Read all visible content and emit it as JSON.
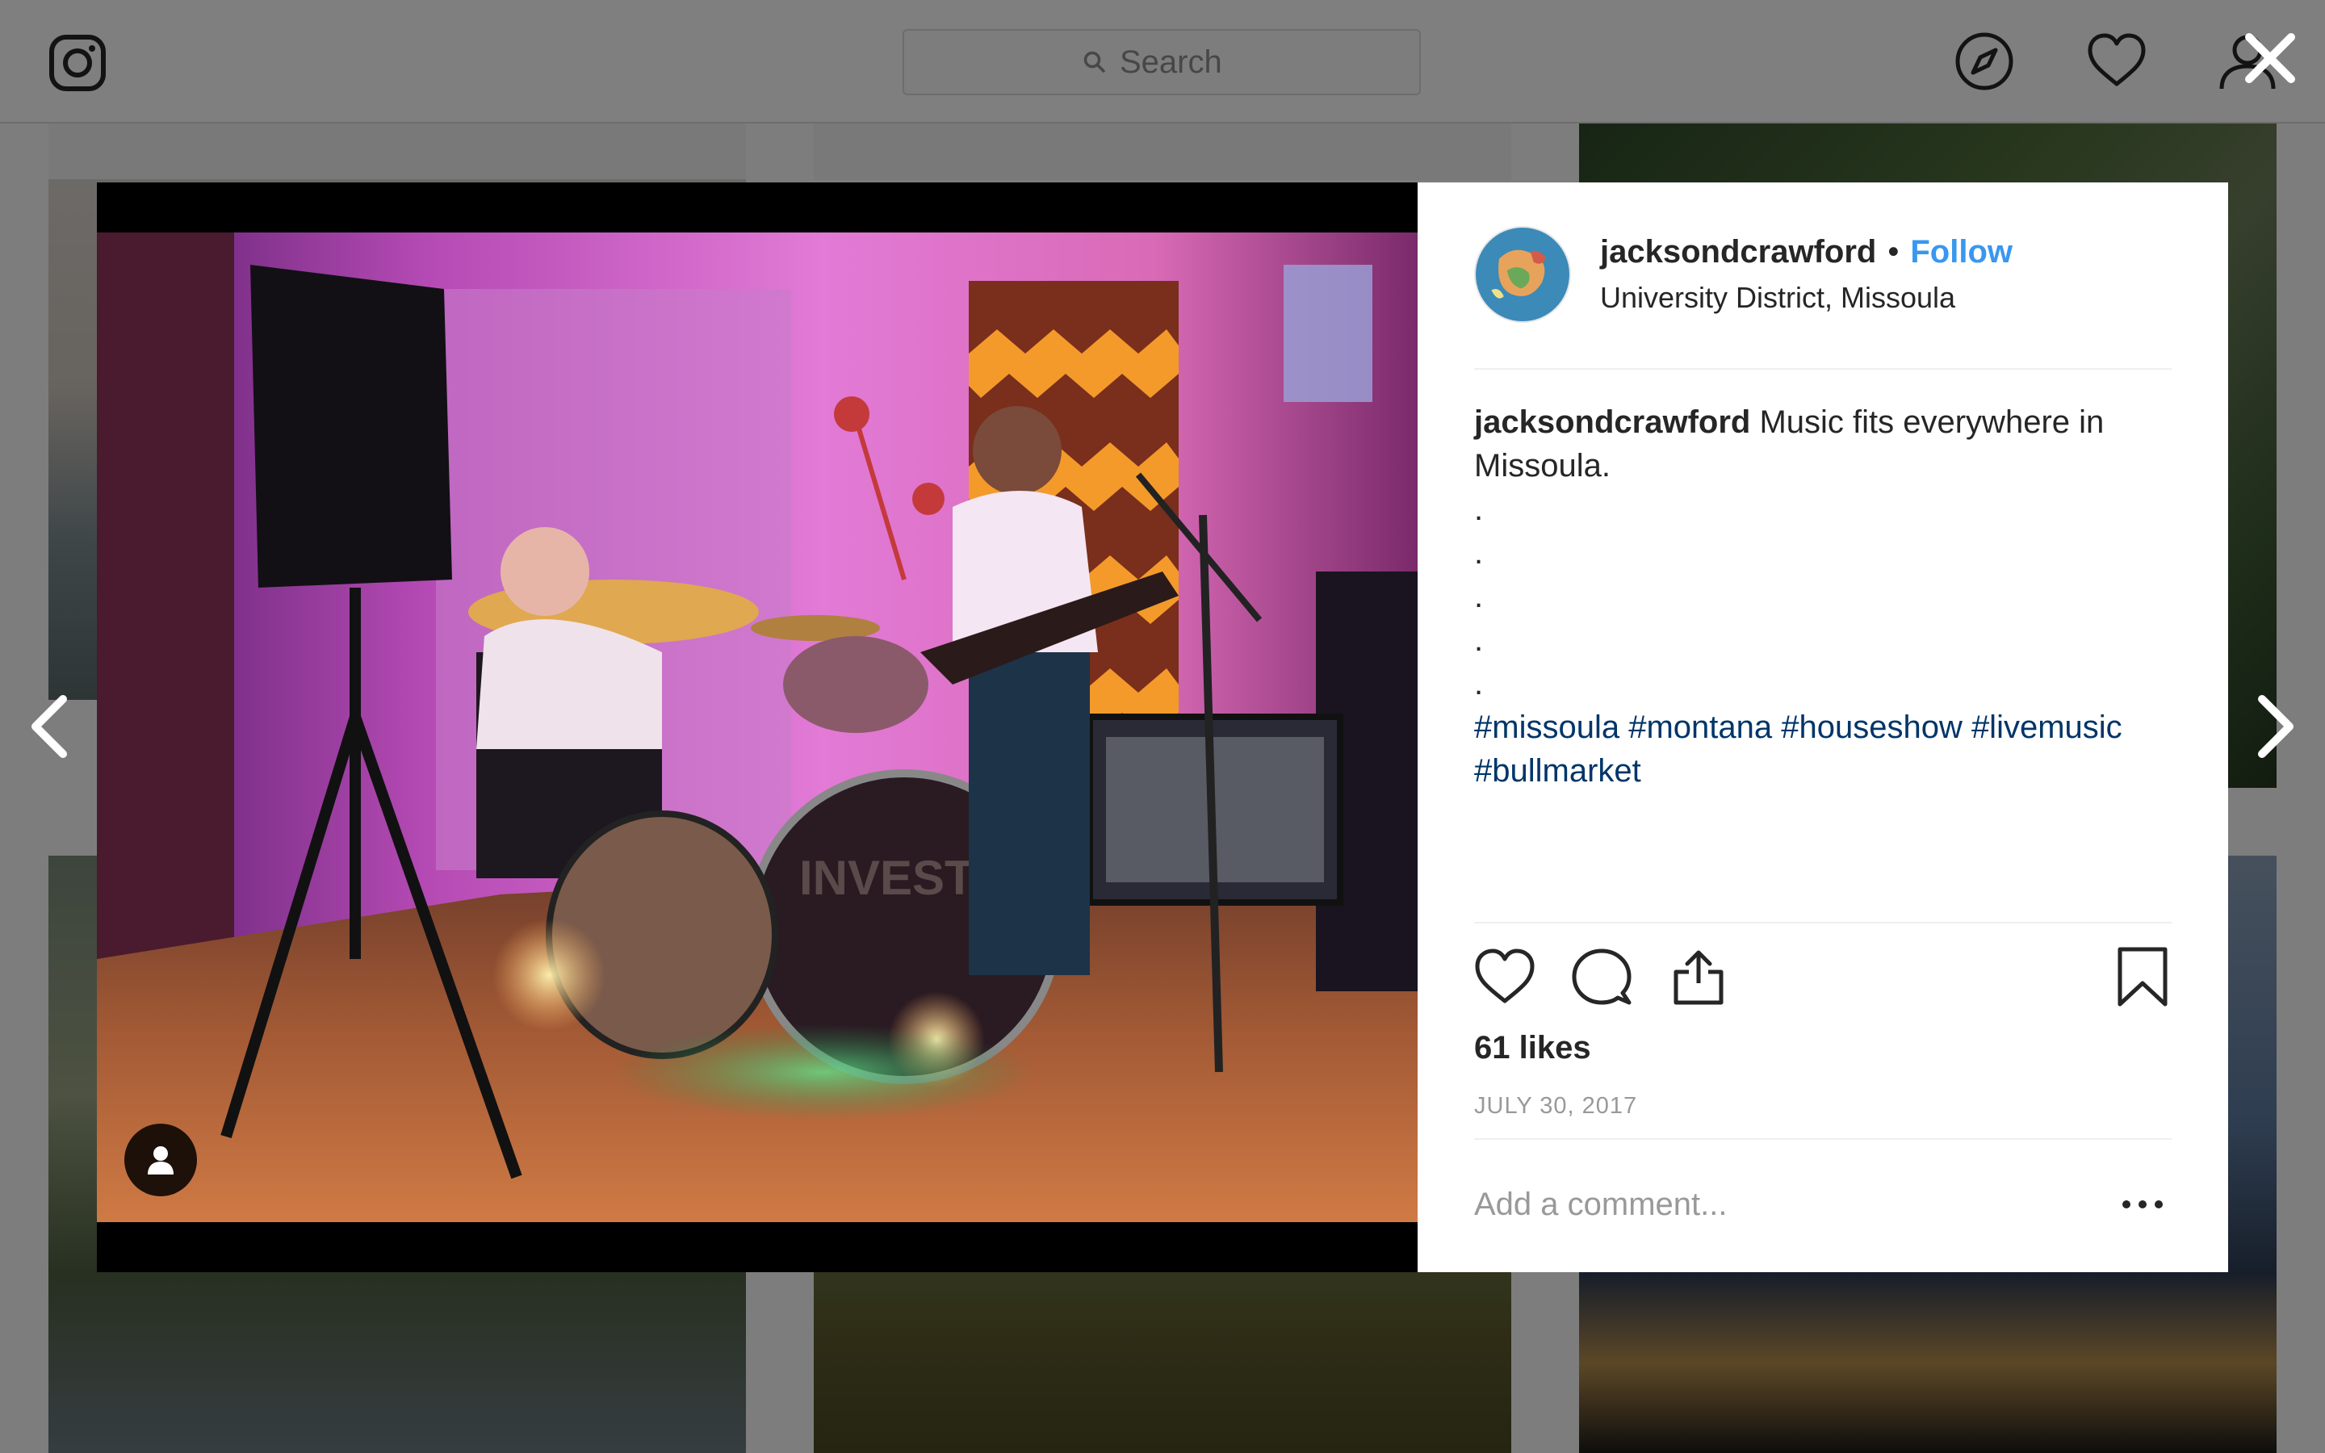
{
  "app": "Instagram",
  "header": {
    "logo_icon": "instagram-camera-icon",
    "search": {
      "placeholder": "Search",
      "value": ""
    },
    "icons": [
      "compass-icon",
      "heart-icon",
      "profile-icon"
    ]
  },
  "modal": {
    "close_icon": "close-x-icon",
    "prev_icon": "chevron-left-icon",
    "next_icon": "chevron-right-icon",
    "media": {
      "tag_icon": "user-tag-icon"
    },
    "post": {
      "username": "jacksondcrawford",
      "separator": "•",
      "follow_label": "Follow",
      "location": "University District, Missoula",
      "caption": {
        "username": "jacksondcrawford",
        "text": "Music fits everywhere in Missoula.",
        "dots": [
          ".",
          ".",
          ".",
          ".",
          "."
        ],
        "hashtags": "#missoula #montana #houseshow #livemusic #bullmarket"
      },
      "actions": [
        "like-icon",
        "comment-icon",
        "share-icon",
        "save-bookmark-icon"
      ],
      "likes": "61 likes",
      "date": "JULY 30, 2017",
      "comment_placeholder": "Add a comment...",
      "more_icon": "more-options-icon"
    }
  }
}
